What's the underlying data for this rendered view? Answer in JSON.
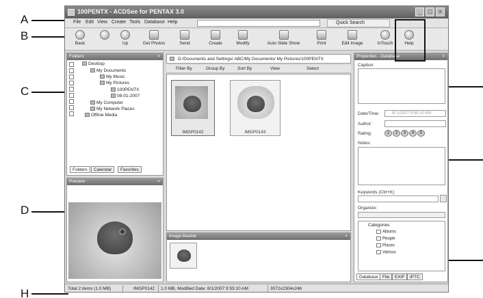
{
  "window": {
    "title": "100PENTX - ACDSee for PENTAX 3.0",
    "buttons": [
      "_",
      "□",
      "×"
    ]
  },
  "menu": [
    "File",
    "Edit",
    "View",
    "Create",
    "Tools",
    "Database",
    "Help"
  ],
  "quick_search": "Quick Search",
  "toolbar": [
    {
      "label": "Back",
      "icon": "back-arrow-icon"
    },
    {
      "label": "Up",
      "icon": "up-arrow-icon"
    },
    {
      "label": "Get Photos",
      "icon": "camera-icon"
    },
    {
      "label": "Send",
      "icon": "send-icon"
    },
    {
      "label": "Create",
      "icon": "create-icon"
    },
    {
      "label": "Modify",
      "icon": "modify-icon"
    },
    {
      "label": "Auto Slide Show",
      "icon": "slideshow-icon"
    },
    {
      "label": "Print",
      "icon": "printer-icon"
    },
    {
      "label": "Edit Image",
      "icon": "edit-image-icon"
    },
    {
      "label": "InTouch",
      "icon": "intouch-icon"
    },
    {
      "label": "Help",
      "icon": "help-icon"
    }
  ],
  "folders": {
    "title": "Folders",
    "tree": [
      "Desktop",
      "My Documents",
      "My Music",
      "My Pictures",
      "100PENTX",
      "08-01-2007",
      "My Computer",
      "My Network Places",
      "Offline Media"
    ],
    "tabs": [
      "Folders",
      "Calendar",
      "Favorites"
    ]
  },
  "preview": {
    "title": "Preview"
  },
  "path": "D:/Documents and Settings/ ABC/My Documents/ My Pictures/100PENTX",
  "filter_bar": [
    "Filter By",
    "Group By",
    "Sort By",
    "View",
    "Select"
  ],
  "thumbnails": [
    {
      "name": "IMGP0142"
    },
    {
      "name": "IMGP0143"
    }
  ],
  "image_basket": {
    "title": "Image Basket"
  },
  "properties": {
    "title": "Properties - Database",
    "caption_label": "Caption:",
    "datetime_label": "Date/Time:",
    "datetime_value": "8/ 1/2007  9:55:10 AM",
    "author_label": "Author:",
    "rating_label": "Rating:",
    "ratings": [
      "1",
      "2",
      "3",
      "4",
      "5"
    ],
    "notes_label": "Notes:",
    "keywords_label": "Keywords (Ctrl+K):",
    "organize_label": "Organize:",
    "categories_title": "Categories",
    "categories": [
      "Albums",
      "People",
      "Places",
      "Various"
    ],
    "tabs": [
      "Database",
      "File",
      "EXIF",
      "IPTC"
    ]
  },
  "status": {
    "total": "Total 2 items  (1.0 MB)",
    "file": "IMGP0142",
    "info": "1.0 MB, Modified Date: 8/1/2007 9:55:10 AM",
    "dims": "3072x2304x24b"
  },
  "callouts": {
    "A": "A",
    "B": "B",
    "C": "C",
    "D": "D",
    "H": "H"
  }
}
